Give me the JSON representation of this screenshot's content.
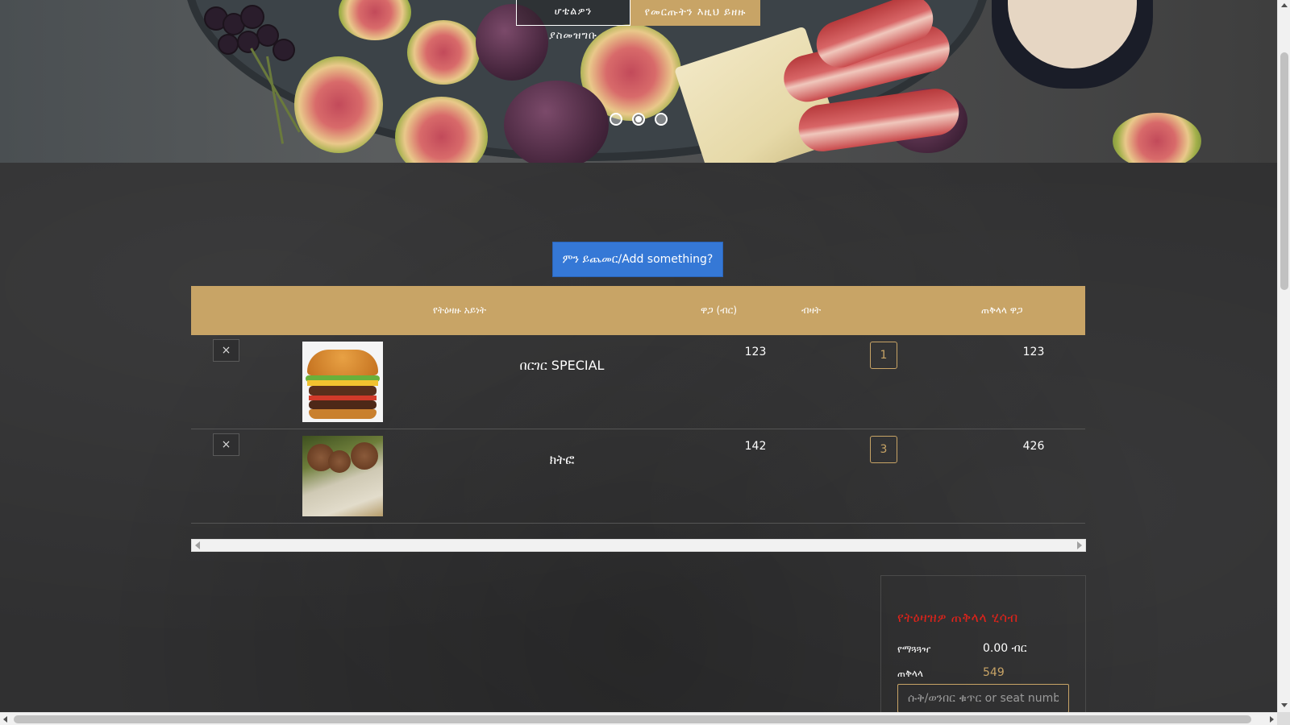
{
  "hero": {
    "btn_menu": "ሆቴልዎን ያስመዝግቡ",
    "btn_order": "የመርጡትን እዚህ ይዘዙ",
    "carousel_dots": 3,
    "active_dot": 2
  },
  "add_button": "ምን ይጨመር/Add something?",
  "table": {
    "headers": {
      "item": "የትዕዛዙ አይነት",
      "price": "ዋጋ (ብር)",
      "qty": "ብዛት",
      "total": "ጠቅላላ ዋጋ"
    },
    "rows": [
      {
        "name": "በርገር SPECIAL",
        "price": "123",
        "qty": "1",
        "total": "123",
        "image": "burger-image"
      },
      {
        "name": "ክትፎ",
        "price": "142",
        "qty": "3",
        "total": "426",
        "image": "kitfo-image"
      }
    ],
    "delete_icon": "×"
  },
  "summary": {
    "title": "የትዕዛዝዎ ጠቅላላ ሂሳብ",
    "delivery_label": "የማጓጓዣ",
    "delivery_value": "0.00 ብር",
    "total_label": "ጠቅላላ",
    "total_value": "549",
    "seat_placeholder": "ሱቅ/ወንበር ቁጥር or seat number"
  },
  "colors": {
    "accent": "#c8a466",
    "button_blue": "#3578d6",
    "summary_title": "#e0231a",
    "background": "#303031"
  }
}
